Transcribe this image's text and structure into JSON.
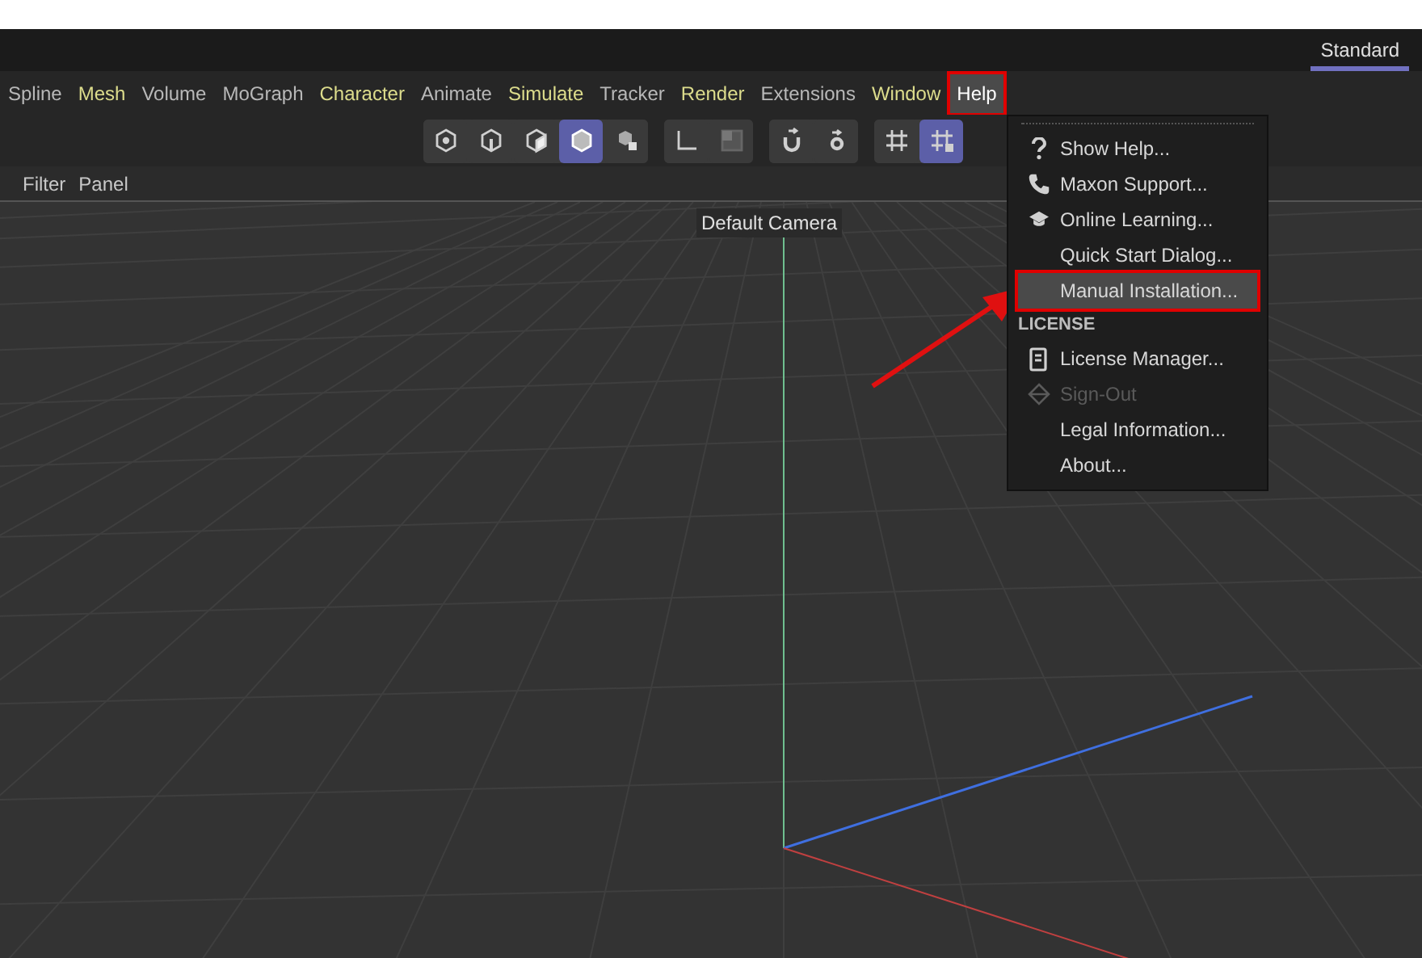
{
  "title_bar": {
    "tabs": [
      {
        "label": "Standard",
        "selected": true
      }
    ]
  },
  "menu_bar": [
    {
      "label": "Spline",
      "accent": false,
      "selected": false
    },
    {
      "label": "Mesh",
      "accent": true,
      "selected": false
    },
    {
      "label": "Volume",
      "accent": false,
      "selected": false
    },
    {
      "label": "MoGraph",
      "accent": false,
      "selected": false
    },
    {
      "label": "Character",
      "accent": true,
      "selected": false
    },
    {
      "label": "Animate",
      "accent": false,
      "selected": false
    },
    {
      "label": "Simulate",
      "accent": true,
      "selected": false
    },
    {
      "label": "Tracker",
      "accent": false,
      "selected": false
    },
    {
      "label": "Render",
      "accent": true,
      "selected": false
    },
    {
      "label": "Extensions",
      "accent": false,
      "selected": false
    },
    {
      "label": "Window",
      "accent": true,
      "selected": false
    },
    {
      "label": "Help",
      "accent": false,
      "selected": true
    }
  ],
  "toolbar": [
    {
      "buttons": [
        {
          "selected": false
        },
        {
          "selected": false
        },
        {
          "selected": false
        },
        {
          "selected": true
        },
        {
          "selected": false
        }
      ]
    },
    {
      "buttons": [
        {
          "selected": false
        },
        {
          "selected": false
        }
      ]
    },
    {
      "buttons": [
        {
          "selected": false
        },
        {
          "selected": false
        }
      ]
    },
    {
      "buttons": [
        {
          "selected": false
        },
        {
          "selected": true
        }
      ]
    }
  ],
  "viewport_menu": [
    "Filter",
    "Panel"
  ],
  "viewport": {
    "camera_label": "Default Camera"
  },
  "help_menu": [
    {
      "kind": "item",
      "label": "Show Help...",
      "disabled": false,
      "selected": false
    },
    {
      "kind": "item",
      "label": "Maxon Support...",
      "disabled": false,
      "selected": false
    },
    {
      "kind": "item",
      "label": "Online Learning...",
      "disabled": false,
      "selected": false
    },
    {
      "kind": "item",
      "label": "Quick Start Dialog...",
      "disabled": false,
      "selected": false
    },
    {
      "kind": "item",
      "label": "Manual Installation...",
      "disabled": false,
      "selected": true
    },
    {
      "kind": "section",
      "label": "LICENSE"
    },
    {
      "kind": "item",
      "label": "License Manager...",
      "disabled": false,
      "selected": false
    },
    {
      "kind": "item",
      "label": "Sign-Out",
      "disabled": true,
      "selected": false
    },
    {
      "kind": "item",
      "label": "Legal Information...",
      "disabled": false,
      "selected": false
    },
    {
      "kind": "item",
      "label": "About...",
      "disabled": false,
      "selected": false
    }
  ]
}
